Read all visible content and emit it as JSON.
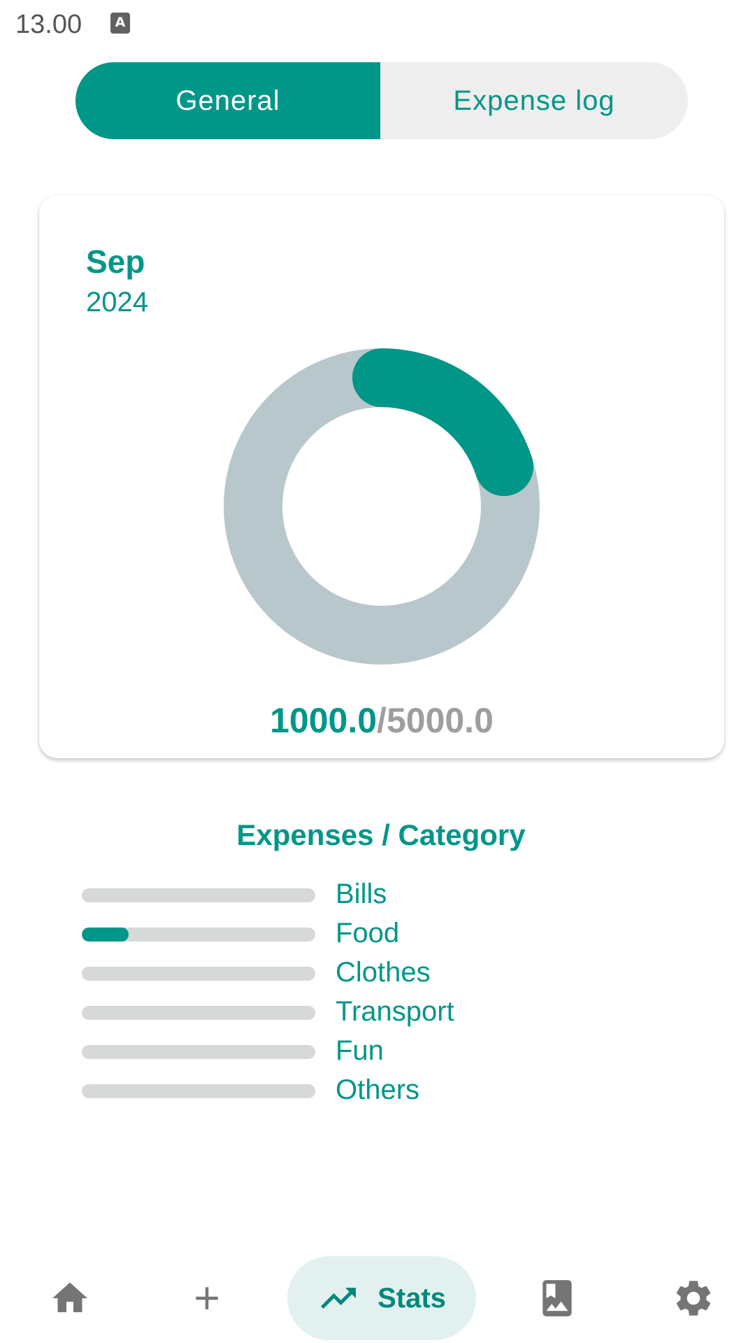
{
  "status_bar": {
    "time": "13.00",
    "notification_glyph": "A"
  },
  "tabs": [
    {
      "label": "General",
      "active": true
    },
    {
      "label": "Expense log",
      "active": false
    }
  ],
  "summary": {
    "month": "Sep",
    "year": "2024",
    "spent": "1000.0",
    "separator": "/",
    "budget": "5000.0"
  },
  "chart_data": {
    "type": "pie",
    "style": "donut",
    "values": [
      1000.0,
      5000.0
    ],
    "spent": 1000.0,
    "budget": 5000.0,
    "fraction_spent": 0.2
  },
  "categories": {
    "title": "Expenses / Category",
    "items": [
      {
        "label": "Bills",
        "fraction": 0
      },
      {
        "label": "Food",
        "fraction": 0.2
      },
      {
        "label": "Clothes",
        "fraction": 0
      },
      {
        "label": "Transport",
        "fraction": 0
      },
      {
        "label": "Fun",
        "fraction": 0
      },
      {
        "label": "Others",
        "fraction": 0
      }
    ]
  },
  "bottom_nav": {
    "items": [
      {
        "icon": "home-icon"
      },
      {
        "icon": "add-icon"
      },
      {
        "icon": "trending-up-icon",
        "label": "Stats",
        "active": true
      },
      {
        "icon": "photo-album-icon"
      },
      {
        "icon": "gear-icon"
      }
    ]
  },
  "colors": {
    "accent": "#009688",
    "track": "#b8c7cb",
    "budget_text": "#9e9e9e",
    "nav_active_bg": "#e2f1ef"
  }
}
